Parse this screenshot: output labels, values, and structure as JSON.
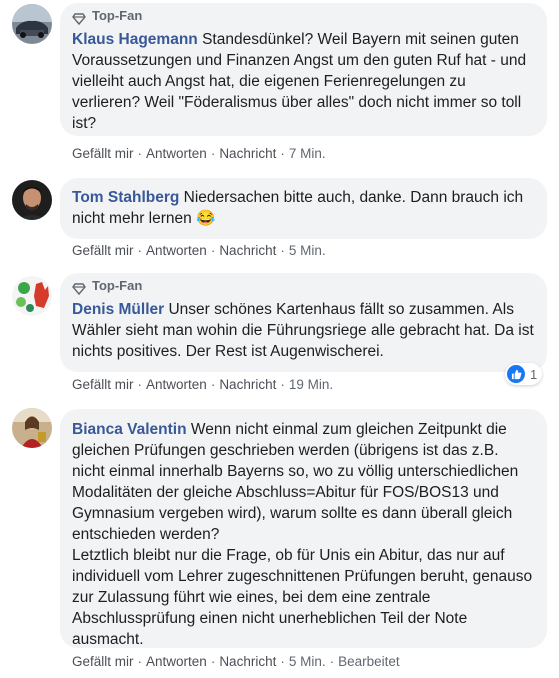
{
  "comments": [
    {
      "badge": "Top-Fan",
      "author": "Klaus Hagemann",
      "text": " Standesdünkel? Weil Bayern mit seinen guten Voraussetzungen und Finanzen Angst um den guten Ruf hat - und vielleiht auch Angst hat, die eigenen Ferienregelungen zu verlieren? Weil \"Föderalismus über alles\" doch nicht immer so toll ist?",
      "like": "Gefällt mir",
      "reply": "Antworten",
      "message": "Nachricht",
      "time": "7 Min."
    },
    {
      "author": "Tom Stahlberg",
      "text": " Niedersachen bitte auch, danke. Dann brauch ich nicht mehr lernen ",
      "emoji": "😂",
      "like": "Gefällt mir",
      "reply": "Antworten",
      "message": "Nachricht",
      "time": "5 Min."
    },
    {
      "badge": "Top-Fan",
      "author": "Denis Müller",
      "text": " Unser schönes Kartenhaus fällt so zusammen. Als Wähler sieht man wohin die Führungsriege alle gebracht hat. Da ist nichts positives. Der Rest ist Augenwischerei.",
      "like": "Gefällt mir",
      "reply": "Antworten",
      "message": "Nachricht",
      "time": "19 Min.",
      "reaction_count": "1"
    },
    {
      "author": "Bianca Valentin",
      "text": " Wenn nicht einmal zum gleichen Zeitpunkt die gleichen Prüfungen geschrieben werden (übrigens ist das z.B. nicht einmal innerhalb Bayerns so, wo zu völlig unterschiedlichen Modalitäten der gleiche Abschluss=Abitur für FOS/BOS13 und Gymnasium vergeben wird), warum sollte es dann überall gleich entschieden werden?\nLetztlich bleibt nur die Frage, ob für Unis ein Abitur, das nur auf individuell vom Lehrer zugeschnittenen Prüfungen beruht, genauso zur Zulassung führt wie eines, bei dem eine zentrale Abschlussprüfung einen nicht unerheblichen Teil der Note ausmacht.",
      "like": "Gefällt mir",
      "reply": "Antworten",
      "message": "Nachricht",
      "time": "5 Min.",
      "edited": "Bearbeitet"
    }
  ],
  "colors": {
    "author": "#385898",
    "bubble": "#f2f3f5",
    "meta": "#606770",
    "like": "#1877f2"
  }
}
